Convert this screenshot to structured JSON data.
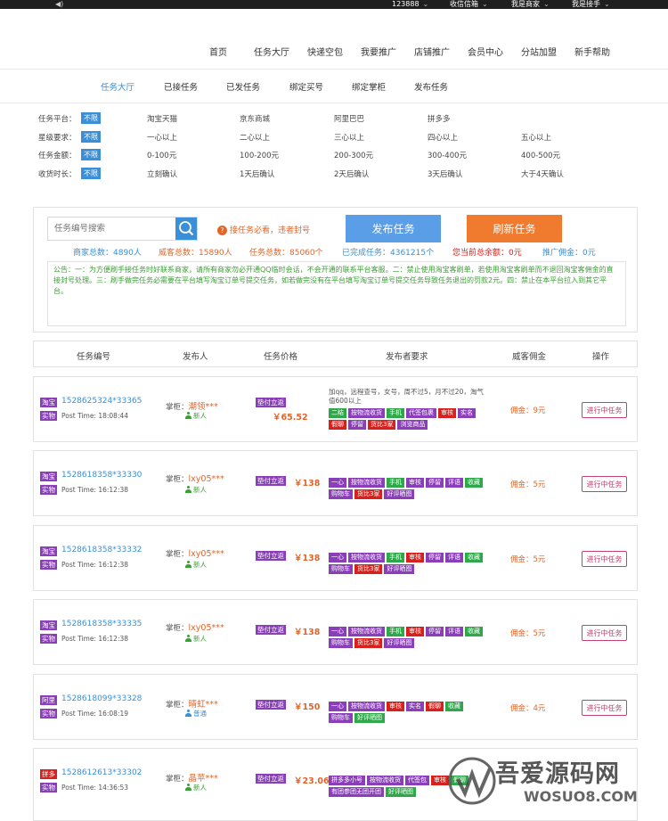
{
  "topbar": {
    "sound_icon": "speaker-icon",
    "user": "123888",
    "wechat": "收信信箱",
    "merchant": "我是商家",
    "receiver": "我是接手"
  },
  "nav": {
    "items": [
      "首页",
      "任务大厅",
      "快递空包",
      "我要推广",
      "店铺推广",
      "会员中心",
      "分站加盟",
      "新手帮助"
    ]
  },
  "subnav": {
    "items": [
      "任务大厅",
      "已接任务",
      "已发任务",
      "绑定买号",
      "绑定掌柜",
      "发布任务"
    ],
    "active_index": 0
  },
  "filters": [
    {
      "label": "任务平台：",
      "all": "不限",
      "options": [
        "淘宝天猫",
        "京东商城",
        "阿里巴巴",
        "拼多多"
      ]
    },
    {
      "label": "星级要求：",
      "all": "不限",
      "options": [
        "一心以上",
        "二心以上",
        "三心以上",
        "四心以上",
        "五心以上"
      ]
    },
    {
      "label": "任务金额：",
      "all": "不限",
      "options": [
        "0-100元",
        "100-200元",
        "200-300元",
        "300-400元",
        "400-500元"
      ]
    },
    {
      "label": "收货时长：",
      "all": "不限",
      "options": [
        "立刻确认",
        "1天后确认",
        "2天后确认",
        "3天后确认",
        "大于4天确认"
      ]
    }
  ],
  "panel": {
    "search_placeholder": "任务编号搜索",
    "warning": "接任务必看，违者封号",
    "publish_button": "发布任务",
    "refresh_button": "刷新任务",
    "stats": [
      {
        "text": "商家总数：4890人",
        "color": "#3a8fd6"
      },
      {
        "text": "威客总数：15890人",
        "color": "#e0662b"
      },
      {
        "text": "任务总数：85060个",
        "color": "#e0662b"
      },
      {
        "text": "已完成任务：4361215个",
        "color": "#3a8fd6"
      },
      {
        "text": "您当前总余额：0元",
        "color": "#d8201c"
      },
      {
        "text": "推广佣金：0元",
        "color": "#3a8fd6"
      }
    ],
    "notice": "公告：一：为方便刷手接任务时好联系商家，请所有商家勿必开通QQ临时会话，不会开通的联系平台客服。二：禁止使用淘宝客刷单，若使用淘宝客刷单而不退回淘宝客佣金的直接封号处理。三：刷手做完任务必需要在平台填写淘宝订单号提交任务，如若做完没有在平台填写淘宝订单号提交任务导致任务退出的罚款2元。四：禁止在本平台拉入到其它平台。"
  },
  "table": {
    "headers": [
      "任务编号",
      "发布人",
      "任务价格",
      "发布者要求",
      "威客佣金",
      "操作"
    ],
    "rows": [
      {
        "platform": "淘宝",
        "type": "实物",
        "task_no": "1528625324*33365",
        "post_time": "Post Time: 18:08:44",
        "publisher_prefix": "掌柜：",
        "publisher": "潮领***",
        "level": "新人",
        "paid_tag": "垫付立返",
        "price": "￥65.52",
        "note": "加qq，远程查号，女号，周不过5，月不过20，淘气值600以上",
        "tags": [
          [
            "二结",
            "green"
          ],
          [
            "按物流收货",
            "purple"
          ],
          [
            "手机",
            "green"
          ],
          [
            "代签包裹",
            "purple"
          ],
          [
            "审核",
            "red"
          ],
          [
            "实名",
            "purple"
          ],
          [
            "假聊",
            "red"
          ],
          [
            "停留",
            "purple"
          ],
          [
            "货比3家",
            "red"
          ],
          [
            "浏览商品",
            "purple"
          ]
        ],
        "commission": "佣金：9元",
        "action": "进行中任务"
      },
      {
        "platform": "淘宝",
        "type": "实物",
        "task_no": "1528618358*33330",
        "post_time": "Post Time: 16:12:38",
        "publisher_prefix": "掌柜：",
        "publisher": "lxy05***",
        "level": "新人",
        "paid_tag": "垫付立返",
        "price": "￥138",
        "note": "",
        "tags": [
          [
            "一心",
            "purple"
          ],
          [
            "按物流收货",
            "purple"
          ],
          [
            "手机",
            "green"
          ],
          [
            "审核",
            "purple"
          ],
          [
            "停留",
            "purple"
          ],
          [
            "评语",
            "purple"
          ],
          [
            "收藏",
            "green"
          ],
          [
            "购物车",
            "purple"
          ],
          [
            "货比3家",
            "red"
          ],
          [
            "好评晒图",
            "purple"
          ]
        ],
        "commission": "佣金：5元",
        "action": "进行中任务"
      },
      {
        "platform": "淘宝",
        "type": "实物",
        "task_no": "1528618358*33332",
        "post_time": "Post Time: 16:12:38",
        "publisher_prefix": "掌柜：",
        "publisher": "lxy05***",
        "level": "新人",
        "paid_tag": "垫付立返",
        "price": "￥138",
        "note": "",
        "tags": [
          [
            "一心",
            "purple"
          ],
          [
            "按物流收货",
            "purple"
          ],
          [
            "手机",
            "green"
          ],
          [
            "审核",
            "red"
          ],
          [
            "停留",
            "purple"
          ],
          [
            "评语",
            "purple"
          ],
          [
            "收藏",
            "green"
          ],
          [
            "购物车",
            "purple"
          ],
          [
            "货比3家",
            "red"
          ],
          [
            "好评晒图",
            "purple"
          ]
        ],
        "commission": "佣金：5元",
        "action": "进行中任务"
      },
      {
        "platform": "淘宝",
        "type": "实物",
        "task_no": "1528618358*33335",
        "post_time": "Post Time: 16:12:38",
        "publisher_prefix": "掌柜：",
        "publisher": "lxy05***",
        "level": "新人",
        "paid_tag": "垫付立返",
        "price": "￥138",
        "note": "",
        "tags": [
          [
            "一心",
            "purple"
          ],
          [
            "按物流收货",
            "purple"
          ],
          [
            "手机",
            "green"
          ],
          [
            "审核",
            "red"
          ],
          [
            "停留",
            "purple"
          ],
          [
            "评语",
            "purple"
          ],
          [
            "收藏",
            "green"
          ],
          [
            "购物车",
            "purple"
          ],
          [
            "货比3家",
            "red"
          ],
          [
            "好评晒图",
            "purple"
          ]
        ],
        "commission": "佣金：5元",
        "action": "进行中任务"
      },
      {
        "platform": "阿里",
        "type": "实物",
        "task_no": "1528618099*33328",
        "post_time": "Post Time: 16:08:19",
        "publisher_prefix": "掌柜：",
        "publisher": "晴虹***",
        "level": "普通",
        "paid_tag": "垫付立返",
        "price": "￥150",
        "note": "",
        "tags": [
          [
            "一心",
            "purple"
          ],
          [
            "按物流收货",
            "purple"
          ],
          [
            "审核",
            "red"
          ],
          [
            "实名",
            "purple"
          ],
          [
            "假聊",
            "red"
          ],
          [
            "收藏",
            "green"
          ],
          [
            "购物车",
            "purple"
          ],
          [
            "好评晒图",
            "green"
          ]
        ],
        "commission": "佣金：4元",
        "action": "进行中任务"
      },
      {
        "platform": "拼多",
        "type": "实物",
        "task_no": "1528612613*33302",
        "post_time": "Post Time: 14:36:53",
        "publisher_prefix": "掌柜：",
        "publisher": "晶苹***",
        "level": "新人",
        "paid_tag": "垫付立返",
        "price": "￥23.06",
        "note": "",
        "tags": [
          [
            "拼多多小号",
            "purple"
          ],
          [
            "按物流收货",
            "purple"
          ],
          [
            "代签包",
            "purple"
          ],
          [
            "审核",
            "red"
          ],
          [
            "假聊",
            "green"
          ],
          [
            "有团参团无团开团",
            "purple"
          ],
          [
            "好评晒图",
            "green"
          ]
        ],
        "commission": "",
        "action": ""
      }
    ]
  },
  "watermark": {
    "text": "吾爱源码网",
    "url": "WOSUO8.COM"
  }
}
